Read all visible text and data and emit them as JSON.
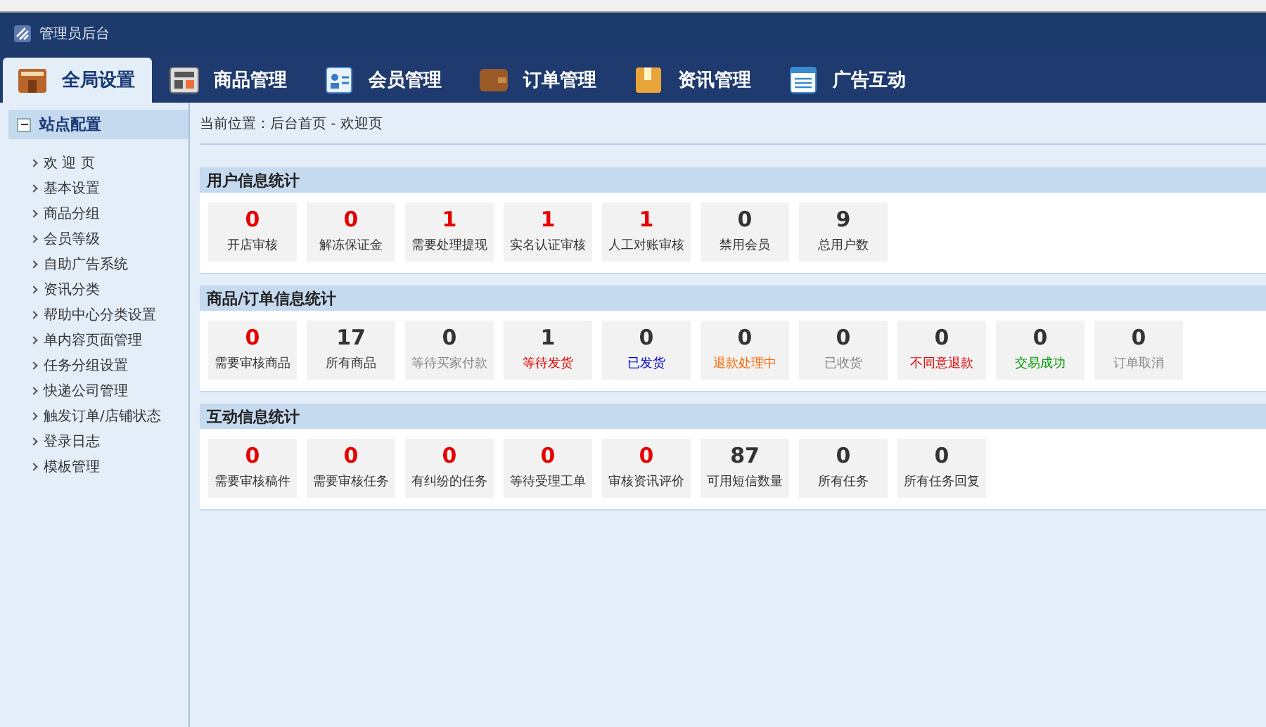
{
  "header": {
    "title": "管理员后台"
  },
  "tabs": [
    {
      "label": "全局设置",
      "selected": true
    },
    {
      "label": "商品管理",
      "selected": false
    },
    {
      "label": "会员管理",
      "selected": false
    },
    {
      "label": "订单管理",
      "selected": false
    },
    {
      "label": "资讯管理",
      "selected": false
    },
    {
      "label": "广告互动",
      "selected": false
    }
  ],
  "sidebar": {
    "title": "站点配置",
    "expanded": true,
    "items": [
      "欢 迎 页",
      "基本设置",
      "商品分组",
      "会员等级",
      "自助广告系统",
      "资讯分类",
      "帮助中心分类设置",
      "单内容页面管理",
      "任务分组设置",
      "快递公司管理",
      "触发订单/店铺状态",
      "登录日志",
      "模板管理"
    ]
  },
  "breadcrumb": "当前位置：后台首页 - 欢迎页",
  "panels": [
    {
      "title": "用户信息统计",
      "stats": [
        {
          "value": "0",
          "label": "开店审核",
          "kind": "alert"
        },
        {
          "value": "0",
          "label": "解冻保证金",
          "kind": "alert"
        },
        {
          "value": "1",
          "label": "需要处理提现",
          "kind": "alert"
        },
        {
          "value": "1",
          "label": "实名认证审核",
          "kind": "alert"
        },
        {
          "value": "1",
          "label": "人工对账审核",
          "kind": "alert"
        },
        {
          "value": "0",
          "label": "禁用会员",
          "kind": "plain"
        },
        {
          "value": "9",
          "label": "总用户数",
          "kind": "plain"
        }
      ]
    },
    {
      "title": "商品/订单信息统计",
      "stats": [
        {
          "value": "0",
          "label": "需要审核商品",
          "kind": "alert"
        },
        {
          "value": "17",
          "label": "所有商品",
          "kind": "plain"
        },
        {
          "value": "0",
          "label": "等待买家付款",
          "kind": "plain",
          "color": "#888888"
        },
        {
          "value": "1",
          "label": "等待发货",
          "kind": "plain",
          "color": "#e00000"
        },
        {
          "value": "0",
          "label": "已发货",
          "kind": "plain",
          "color": "#0000cc"
        },
        {
          "value": "0",
          "label": "退款处理中",
          "kind": "plain",
          "color": "#ff6600"
        },
        {
          "value": "0",
          "label": "已收货",
          "kind": "plain",
          "color": "#888888"
        },
        {
          "value": "0",
          "label": "不同意退款",
          "kind": "plain",
          "color": "#e00000"
        },
        {
          "value": "0",
          "label": "交易成功",
          "kind": "plain",
          "color": "#009900"
        },
        {
          "value": "0",
          "label": "订单取消",
          "kind": "plain",
          "color": "#888888"
        }
      ]
    },
    {
      "title": "互动信息统计",
      "stats": [
        {
          "value": "0",
          "label": "需要审核稿件",
          "kind": "alert"
        },
        {
          "value": "0",
          "label": "需要审核任务",
          "kind": "alert"
        },
        {
          "value": "0",
          "label": "有纠纷的任务",
          "kind": "alert"
        },
        {
          "value": "0",
          "label": "等待受理工单",
          "kind": "alert"
        },
        {
          "value": "0",
          "label": "审核资讯评价",
          "kind": "alert"
        },
        {
          "value": "87",
          "label": "可用短信数量",
          "kind": "plain"
        },
        {
          "value": "0",
          "label": "所有任务",
          "kind": "plain"
        },
        {
          "value": "0",
          "label": "所有任务回复",
          "kind": "plain"
        }
      ]
    }
  ]
}
